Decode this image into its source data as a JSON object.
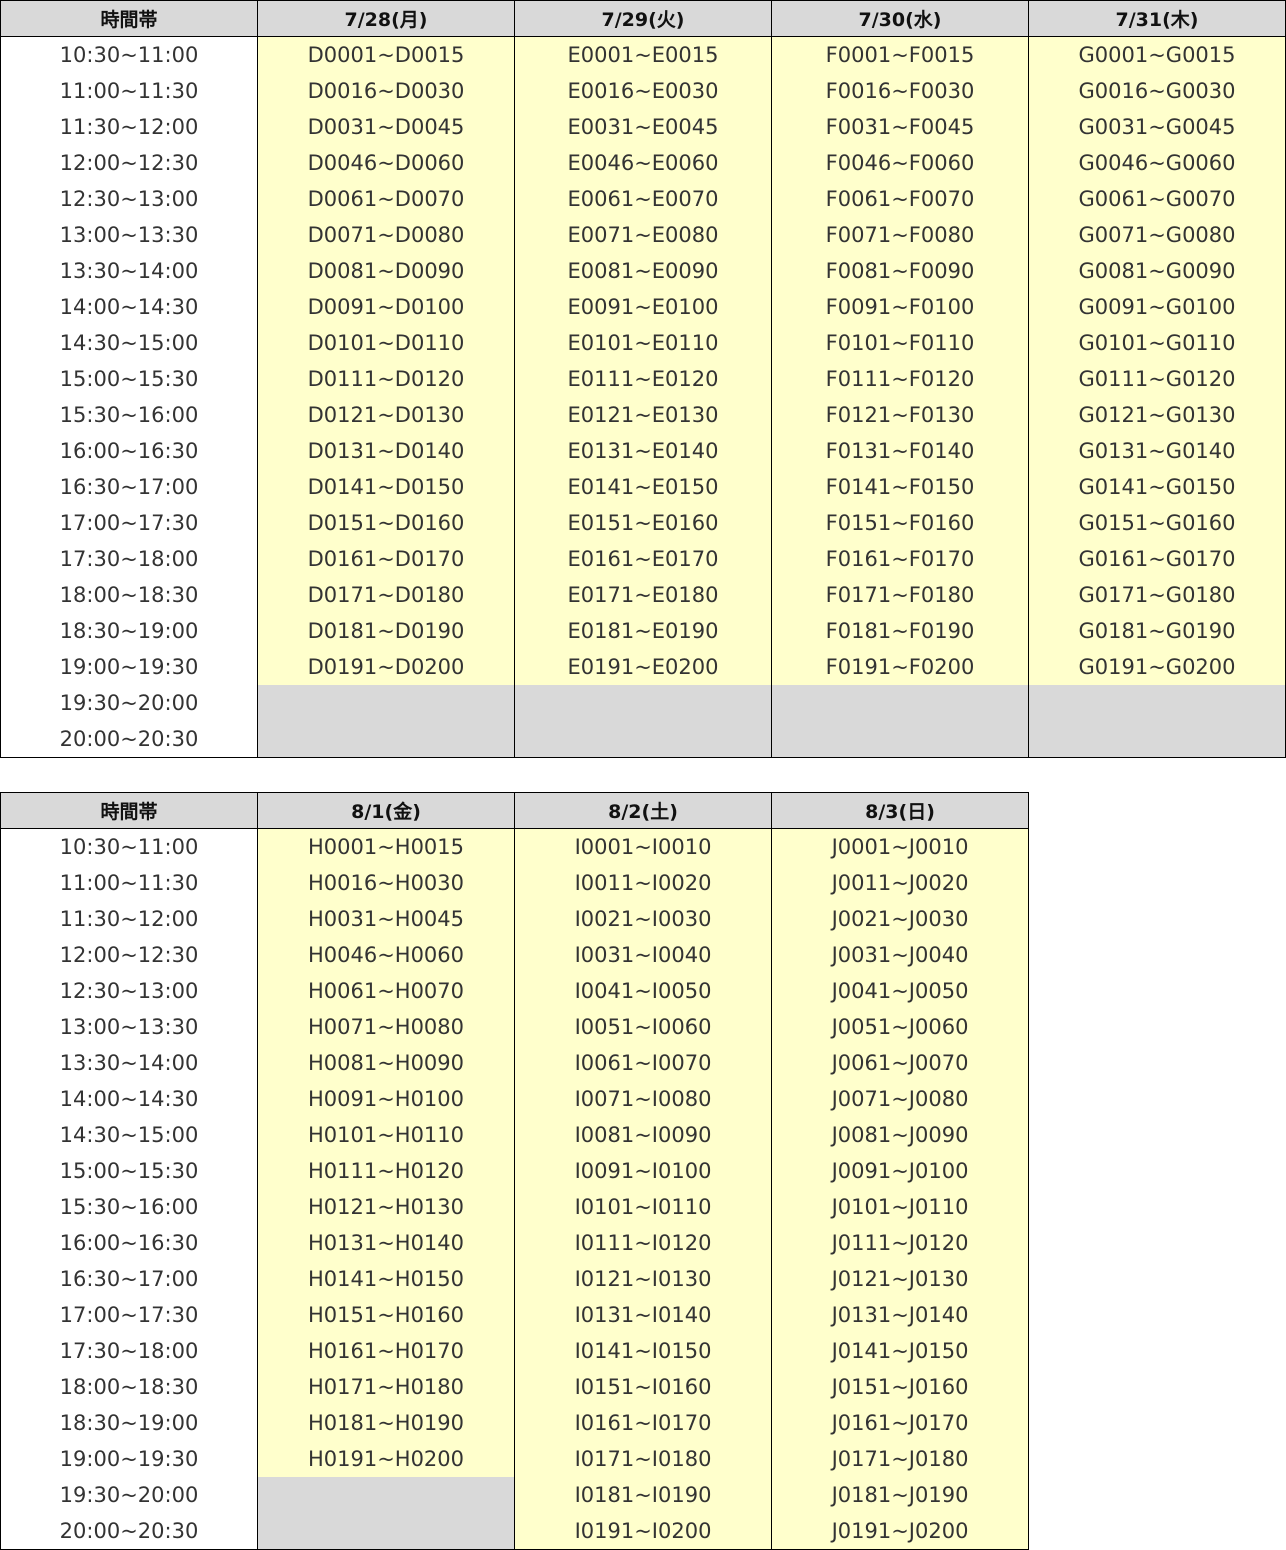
{
  "colors": {
    "header_bg": "#d9d9d9",
    "cell_bg": "#ffffcc",
    "empty_bg": "#d9d9d9",
    "border": "#000000"
  },
  "time_slots": [
    "10:30~11:00",
    "11:00~11:30",
    "11:30~12:00",
    "12:00~12:30",
    "12:30~13:00",
    "13:00~13:30",
    "13:30~14:00",
    "14:00~14:30",
    "14:30~15:00",
    "15:00~15:30",
    "15:30~16:00",
    "16:00~16:30",
    "16:30~17:00",
    "17:00~17:30",
    "17:30~18:00",
    "18:00~18:30",
    "18:30~19:00",
    "19:00~19:30",
    "19:30~20:00",
    "20:00~20:30"
  ],
  "tables": [
    {
      "header_time": "時間帯",
      "columns": [
        {
          "date": "7/28(月)",
          "ranges": [
            "D0001~D0015",
            "D0016~D0030",
            "D0031~D0045",
            "D0046~D0060",
            "D0061~D0070",
            "D0071~D0080",
            "D0081~D0090",
            "D0091~D0100",
            "D0101~D0110",
            "D0111~D0120",
            "D0121~D0130",
            "D0131~D0140",
            "D0141~D0150",
            "D0151~D0160",
            "D0161~D0170",
            "D0171~D0180",
            "D0181~D0190",
            "D0191~D0200",
            "",
            ""
          ]
        },
        {
          "date": "7/29(火)",
          "ranges": [
            "E0001~E0015",
            "E0016~E0030",
            "E0031~E0045",
            "E0046~E0060",
            "E0061~E0070",
            "E0071~E0080",
            "E0081~E0090",
            "E0091~E0100",
            "E0101~E0110",
            "E0111~E0120",
            "E0121~E0130",
            "E0131~E0140",
            "E0141~E0150",
            "E0151~E0160",
            "E0161~E0170",
            "E0171~E0180",
            "E0181~E0190",
            "E0191~E0200",
            "",
            ""
          ]
        },
        {
          "date": "7/30(水)",
          "ranges": [
            "F0001~F0015",
            "F0016~F0030",
            "F0031~F0045",
            "F0046~F0060",
            "F0061~F0070",
            "F0071~F0080",
            "F0081~F0090",
            "F0091~F0100",
            "F0101~F0110",
            "F0111~F0120",
            "F0121~F0130",
            "F0131~F0140",
            "F0141~F0150",
            "F0151~F0160",
            "F0161~F0170",
            "F0171~F0180",
            "F0181~F0190",
            "F0191~F0200",
            "",
            ""
          ]
        },
        {
          "date": "7/31(木)",
          "ranges": [
            "G0001~G0015",
            "G0016~G0030",
            "G0031~G0045",
            "G0046~G0060",
            "G0061~G0070",
            "G0071~G0080",
            "G0081~G0090",
            "G0091~G0100",
            "G0101~G0110",
            "G0111~G0120",
            "G0121~G0130",
            "G0131~G0140",
            "G0141~G0150",
            "G0151~G0160",
            "G0161~G0170",
            "G0171~G0180",
            "G0181~G0190",
            "G0191~G0200",
            "",
            ""
          ]
        }
      ]
    },
    {
      "header_time": "時間帯",
      "columns": [
        {
          "date": "8/1(金)",
          "ranges": [
            "H0001~H0015",
            "H0016~H0030",
            "H0031~H0045",
            "H0046~H0060",
            "H0061~H0070",
            "H0071~H0080",
            "H0081~H0090",
            "H0091~H0100",
            "H0101~H0110",
            "H0111~H0120",
            "H0121~H0130",
            "H0131~H0140",
            "H0141~H0150",
            "H0151~H0160",
            "H0161~H0170",
            "H0171~H0180",
            "H0181~H0190",
            "H0191~H0200",
            "",
            ""
          ]
        },
        {
          "date": "8/2(土)",
          "ranges": [
            "I0001~I0010",
            "I0011~I0020",
            "I0021~I0030",
            "I0031~I0040",
            "I0041~I0050",
            "I0051~I0060",
            "I0061~I0070",
            "I0071~I0080",
            "I0081~I0090",
            "I0091~I0100",
            "I0101~I0110",
            "I0111~I0120",
            "I0121~I0130",
            "I0131~I0140",
            "I0141~I0150",
            "I0151~I0160",
            "I0161~I0170",
            "I0171~I0180",
            "I0181~I0190",
            "I0191~I0200"
          ]
        },
        {
          "date": "8/3(日)",
          "ranges": [
            "J0001~J0010",
            "J0011~J0020",
            "J0021~J0030",
            "J0031~J0040",
            "J0041~J0050",
            "J0051~J0060",
            "J0061~J0070",
            "J0071~J0080",
            "J0081~J0090",
            "J0091~J0100",
            "J0101~J0110",
            "J0111~J0120",
            "J0121~J0130",
            "J0131~J0140",
            "J0141~J0150",
            "J0151~J0160",
            "J0161~J0170",
            "J0171~J0180",
            "J0181~J0190",
            "J0191~J0200"
          ]
        }
      ]
    }
  ]
}
